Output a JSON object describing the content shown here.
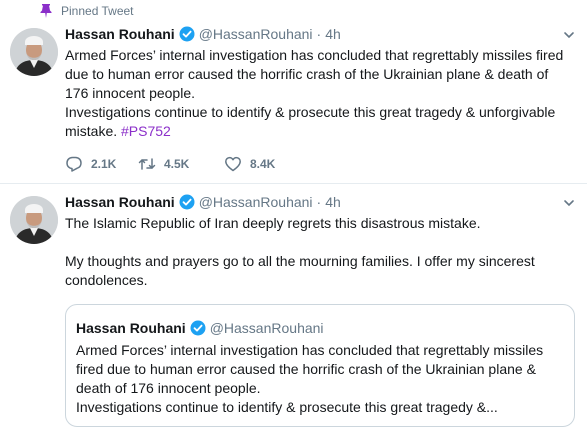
{
  "pinned_label": "Pinned Tweet",
  "colors": {
    "verified": "#1da1f2",
    "hashtag": "#8b2fc9",
    "secondary": "#657786"
  },
  "tweet1": {
    "name": "Hassan Rouhani",
    "handle": "@HassanRouhani",
    "dot": "·",
    "time": "4h",
    "lines": [
      "Armed Forces’ internal investigation has concluded that regrettably missiles fired",
      "due to human error caused the horrific crash of the Ukrainian plane & death of",
      "176 innocent people.",
      "Investigations continue to identify & prosecute this great tragedy & unforgivable"
    ],
    "last_line": "mistake. ",
    "hashtag": "#PS752",
    "replies": "2.1K",
    "retweets": "4.5K",
    "likes": "8.4K"
  },
  "tweet2": {
    "name": "Hassan Rouhani",
    "handle": "@HassanRouhani",
    "dot": "·",
    "time": "4h",
    "para1": "The Islamic Republic of Iran deeply regrets this disastrous mistake.",
    "para2_lines": [
      "My thoughts and prayers go to all the mourning families. I offer my sincerest",
      "condolences."
    ],
    "quote": {
      "name": "Hassan Rouhani",
      "handle": "@HassanRouhani",
      "lines": [
        "Armed Forces’ internal investigation has concluded that regrettably missiles",
        "fired due to human error caused the horrific crash of the Ukrainian plane &",
        "death of 176 innocent people.",
        "Investigations continue to identify & prosecute this great tragedy &..."
      ]
    }
  }
}
